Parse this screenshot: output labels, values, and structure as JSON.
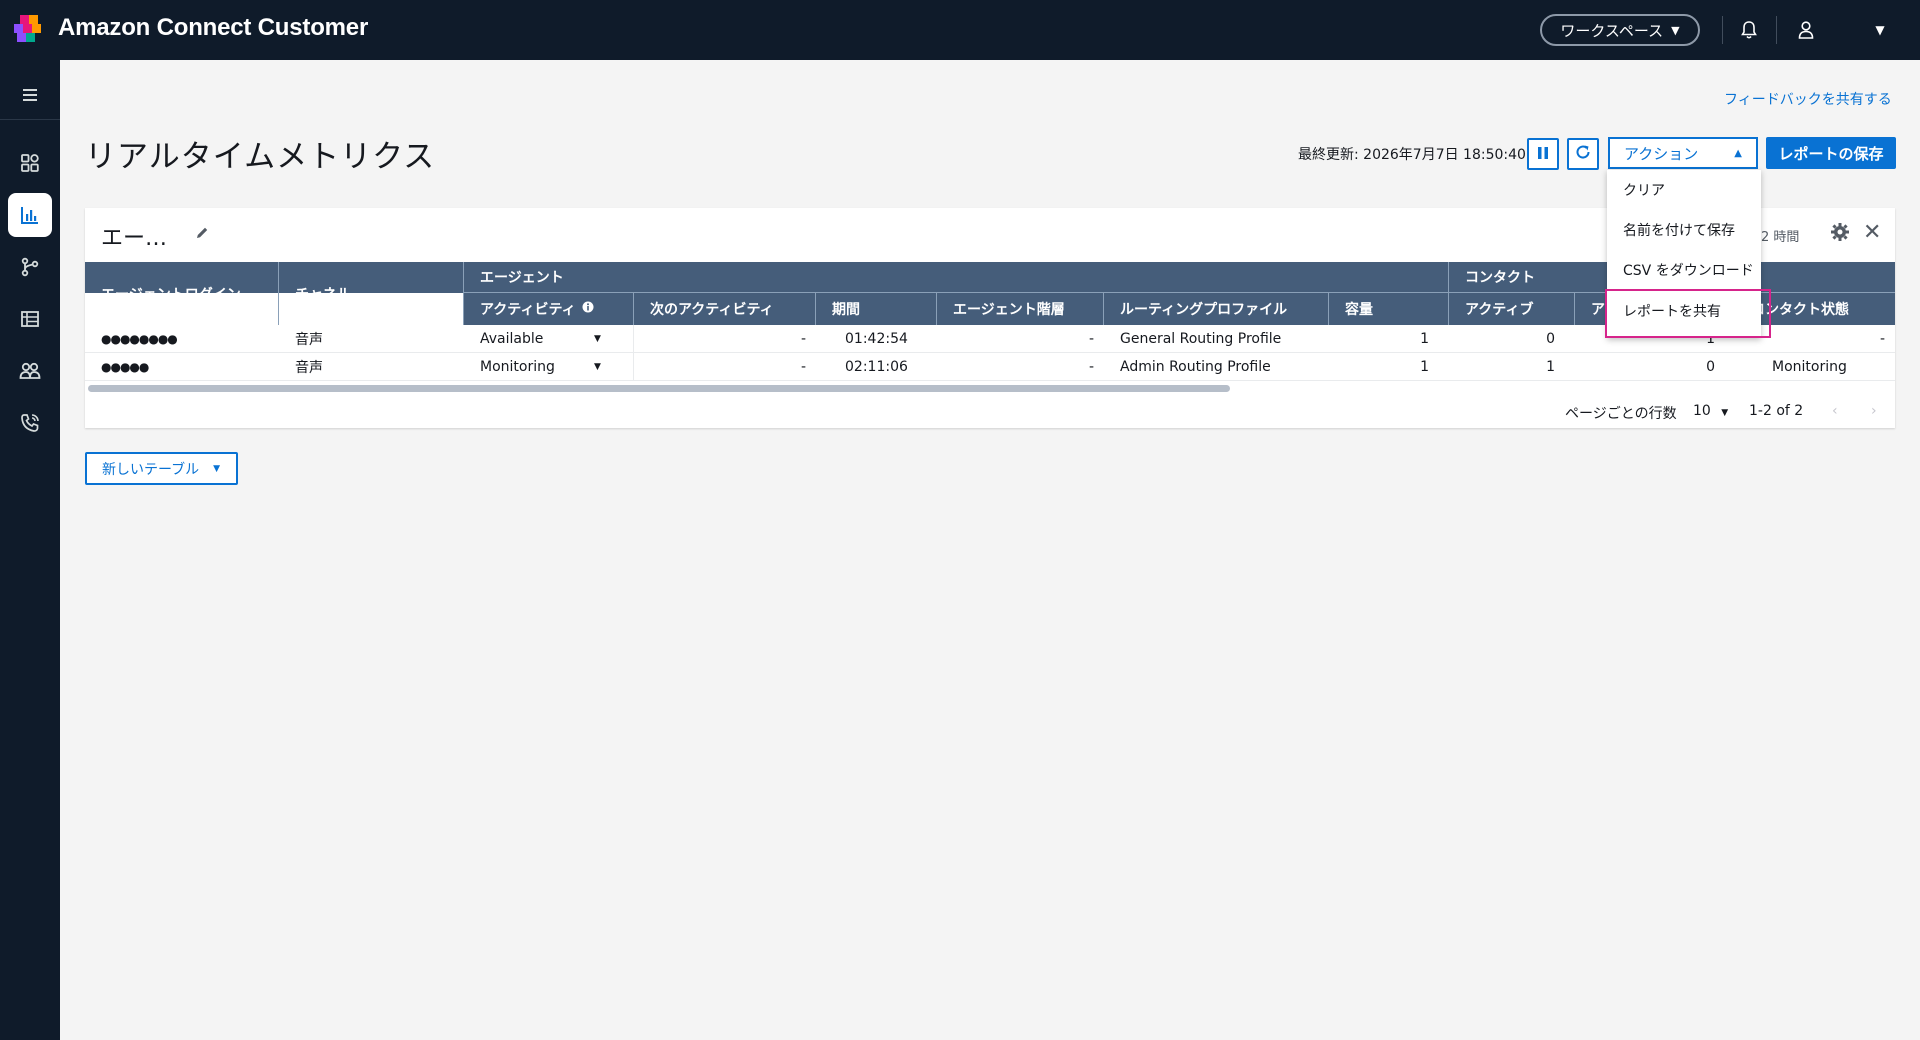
{
  "app": {
    "brand": "Amazon Connect Customer"
  },
  "topbar": {
    "workspace_label": "ワークスペース",
    "icons": [
      "bell-icon",
      "user-icon",
      "caret-down-icon"
    ]
  },
  "sidebar": {
    "items": [
      "menu-icon",
      "dashboard-icon",
      "metrics-icon",
      "flows-icon",
      "table-icon",
      "users-icon",
      "phone-icon"
    ]
  },
  "header": {
    "feedback_link": "フィードバックを共有する",
    "title": "リアルタイムメトリクス",
    "last_updated": "最終更新: 2026年7月7日 18:50:40",
    "actions_label": "アクション",
    "save_label": "レポートの保存"
  },
  "actions_menu": {
    "items": [
      "クリア",
      "名前を付けて保存",
      "CSV をダウンロード",
      "レポートを共有"
    ]
  },
  "card": {
    "title": "エー…",
    "time_range": "2 時間",
    "group_headers": {
      "agent": "エージェント",
      "contact": "コンタクト"
    },
    "columns": {
      "login": "エージェントログイン",
      "channel": "チャネル",
      "activity": "アクティビティ",
      "next_activity": "次のアクティビティ",
      "duration": "期間",
      "hierarchy": "エージェント階層",
      "routing_profile": "ルーティングプロファイル",
      "capacity": "容量",
      "active": "アクティブ",
      "a_col": "ア",
      "contact_state": "コンタクト状態"
    },
    "rows": [
      {
        "login": "●●●●●●●●",
        "channel": "音声",
        "activity": "Available",
        "next": "-",
        "duration": "01:42:54",
        "hierarchy": "-",
        "routing": "General Routing Profile",
        "capacity": "1",
        "active": "0",
        "a_col": "1",
        "state": "-"
      },
      {
        "login": "●●●●●",
        "channel": "音声",
        "activity": "Monitoring",
        "next": "-",
        "duration": "02:11:06",
        "hierarchy": "-",
        "routing": "Admin Routing Profile",
        "capacity": "1",
        "active": "1",
        "a_col": "0",
        "state": "Monitoring"
      }
    ],
    "pagination": {
      "rows_label": "ページごとの行数",
      "rows_value": "10",
      "range": "1-2 of 2"
    }
  },
  "new_table_label": "新しいテーブル"
}
